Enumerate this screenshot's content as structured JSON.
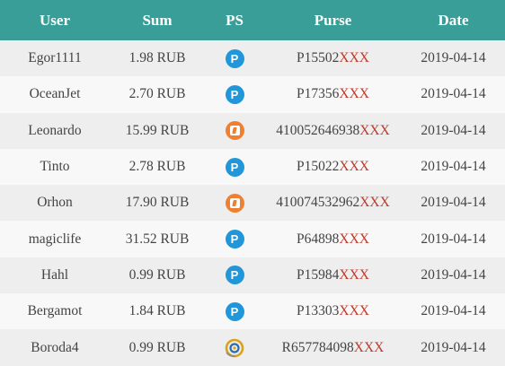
{
  "table": {
    "headers": {
      "user": "User",
      "sum": "Sum",
      "ps": "PS",
      "purse": "Purse",
      "date": "Date"
    },
    "rows": [
      {
        "user": "Egor1111",
        "sum": "1.98 RUB",
        "ps": "payeer-icon",
        "ps_glyph": "P",
        "purse": "P15502",
        "purse_mask": "XXX",
        "date": "2019-04-14"
      },
      {
        "user": "OceanJet",
        "sum": "2.70 RUB",
        "ps": "payeer-icon",
        "ps_glyph": "P",
        "purse": "P17356",
        "purse_mask": "XXX",
        "date": "2019-04-14"
      },
      {
        "user": "Leonardo",
        "sum": "15.99 RUB",
        "ps": "yandex-money-icon",
        "purse": "410052646938",
        "purse_mask": "XXX",
        "date": "2019-04-14"
      },
      {
        "user": "Tinto",
        "sum": "2.78 RUB",
        "ps": "payeer-icon",
        "ps_glyph": "P",
        "purse": "P15022",
        "purse_mask": "XXX",
        "date": "2019-04-14"
      },
      {
        "user": "Orhon",
        "sum": "17.90 RUB",
        "ps": "yandex-money-icon",
        "purse": "410074532962",
        "purse_mask": "XXX",
        "date": "2019-04-14"
      },
      {
        "user": "magiclife",
        "sum": "31.52 RUB",
        "ps": "payeer-icon",
        "ps_glyph": "P",
        "purse": "P64898",
        "purse_mask": "XXX",
        "date": "2019-04-14"
      },
      {
        "user": "Hahl",
        "sum": "0.99 RUB",
        "ps": "payeer-icon",
        "ps_glyph": "P",
        "purse": "P15984",
        "purse_mask": "XXX",
        "date": "2019-04-14"
      },
      {
        "user": "Bergamot",
        "sum": "1.84 RUB",
        "ps": "payeer-icon",
        "ps_glyph": "P",
        "purse": "P13303",
        "purse_mask": "XXX",
        "date": "2019-04-14"
      },
      {
        "user": "Boroda4",
        "sum": "0.99 RUB",
        "ps": "webmoney-icon",
        "purse": "R657784098",
        "purse_mask": "XXX",
        "date": "2019-04-14"
      }
    ]
  },
  "colors": {
    "header_bg": "#3a9e98",
    "header_text": "#ffffff",
    "row_odd": "#eeeeee",
    "row_even": "#f8f8f8",
    "mask": "#c0392b",
    "payeer": "#2196d9",
    "yandex": "#f07f2f",
    "webmoney": "#d9a21b"
  }
}
